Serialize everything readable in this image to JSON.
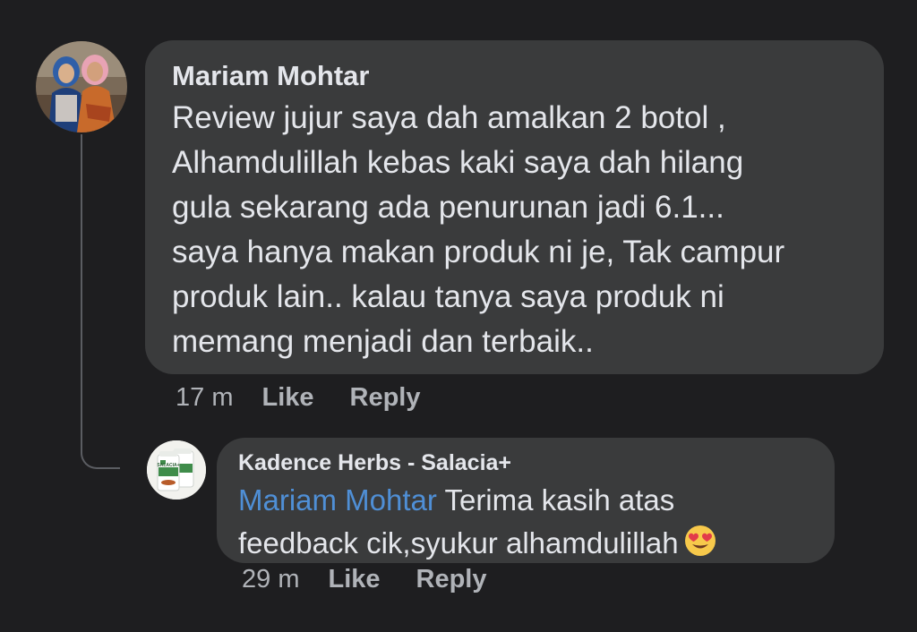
{
  "comment": {
    "author": "Mariam Mohtar",
    "lines": [
      "Review jujur saya dah amalkan 2 botol ,",
      "Alhamdulillah kebas kaki saya dah hilang",
      "gula sekarang ada penurunan jadi 6.1...",
      "saya hanya makan produk ni je, Tak campur",
      "produk lain.. kalau tanya saya produk ni",
      "memang menjadi dan terbaik.."
    ],
    "time": "17 m",
    "like_label": "Like",
    "reply_label": "Reply"
  },
  "reply": {
    "author": "Kadence Herbs - Salacia+",
    "mention": "Mariam Mohtar",
    "line1_text": " Terima kasih atas",
    "line2_text": "feedback cik,syukur alhamdulillah",
    "emoji": "smiling-face-with-heart-eyes",
    "time": "29 m",
    "like_label": "Like",
    "reply_label": "Reply",
    "avatar_product_text": "SALACIA+"
  },
  "colors": {
    "background": "#1e1e20",
    "bubble": "#3a3b3c",
    "text": "#e4e6eb",
    "muted": "#b0b3b8",
    "mention": "#4f8fd6"
  }
}
